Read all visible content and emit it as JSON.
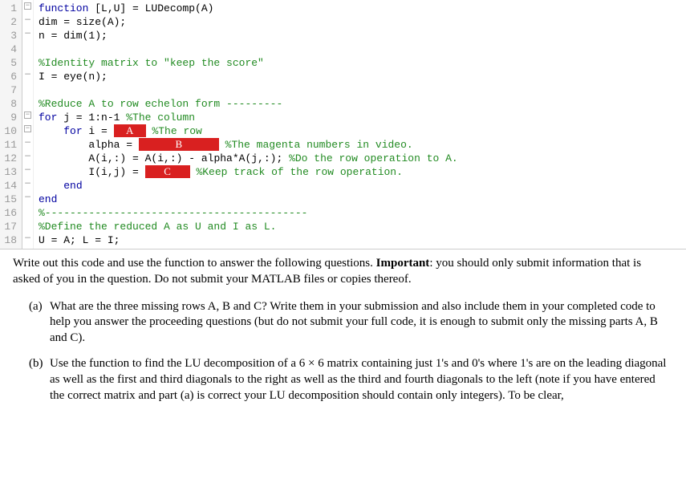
{
  "code": {
    "lines": [
      {
        "n": "1",
        "dash": "",
        "fold": "box",
        "segs": [
          {
            "t": "function",
            "c": "kw"
          },
          {
            "t": " [L,U] = LUDecomp(A)",
            "c": "fn"
          }
        ]
      },
      {
        "n": "2",
        "dash": "—",
        "fold": "",
        "segs": [
          {
            "t": "dim = size(A);",
            "c": "fn"
          }
        ]
      },
      {
        "n": "3",
        "dash": "—",
        "fold": "",
        "segs": [
          {
            "t": "n = dim(1);",
            "c": "fn"
          }
        ]
      },
      {
        "n": "4",
        "dash": "",
        "fold": "",
        "segs": [
          {
            "t": " ",
            "c": "fn"
          }
        ]
      },
      {
        "n": "5",
        "dash": "",
        "fold": "",
        "segs": [
          {
            "t": "%Identity matrix to \"keep the score\"",
            "c": "com"
          }
        ]
      },
      {
        "n": "6",
        "dash": "—",
        "fold": "",
        "segs": [
          {
            "t": "I = eye(n);",
            "c": "fn"
          }
        ]
      },
      {
        "n": "7",
        "dash": "",
        "fold": "",
        "segs": [
          {
            "t": " ",
            "c": "fn"
          }
        ]
      },
      {
        "n": "8",
        "dash": "",
        "fold": "",
        "segs": [
          {
            "t": "%Reduce A to row echelon form ---------",
            "c": "com"
          }
        ]
      },
      {
        "n": "9",
        "dash": "—",
        "fold": "box",
        "segs": [
          {
            "t": "for",
            "c": "kw"
          },
          {
            "t": " j = 1:n-1 ",
            "c": "fn"
          },
          {
            "t": "%The column",
            "c": "com"
          }
        ]
      },
      {
        "n": "10",
        "dash": "—",
        "fold": "box",
        "indent": 4,
        "segs": [
          {
            "t": "for",
            "c": "kw"
          },
          {
            "t": " i = ",
            "c": "fn"
          },
          {
            "box": "A",
            "w": "box-a"
          },
          {
            "t": " ",
            "c": "fn"
          },
          {
            "t": "%The row",
            "c": "com"
          }
        ]
      },
      {
        "n": "11",
        "dash": "—",
        "fold": "",
        "indent": 8,
        "segs": [
          {
            "t": "alpha = ",
            "c": "fn"
          },
          {
            "box": "B",
            "w": "box-b"
          },
          {
            "t": " ",
            "c": "fn"
          },
          {
            "t": "%The magenta numbers in video.",
            "c": "com"
          }
        ]
      },
      {
        "n": "12",
        "dash": "—",
        "fold": "",
        "indent": 8,
        "segs": [
          {
            "t": "A(i,:) = A(i,:) - alpha*A(j,:); ",
            "c": "fn"
          },
          {
            "t": "%Do the row operation to A.",
            "c": "com"
          }
        ]
      },
      {
        "n": "13",
        "dash": "—",
        "fold": "",
        "indent": 8,
        "segs": [
          {
            "t": "I(i,j) = ",
            "c": "fn"
          },
          {
            "box": "C",
            "w": "box-c"
          },
          {
            "t": " ",
            "c": "fn"
          },
          {
            "t": "%Keep track of the row operation.",
            "c": "com"
          }
        ]
      },
      {
        "n": "14",
        "dash": "—",
        "fold": "",
        "indent": 4,
        "segs": [
          {
            "t": "end",
            "c": "kw"
          }
        ]
      },
      {
        "n": "15",
        "dash": "—",
        "fold": "",
        "segs": [
          {
            "t": "end",
            "c": "kw"
          }
        ]
      },
      {
        "n": "16",
        "dash": "",
        "fold": "",
        "segs": [
          {
            "t": "%------------------------------------------",
            "c": "com"
          }
        ]
      },
      {
        "n": "17",
        "dash": "",
        "fold": "",
        "segs": [
          {
            "t": "%Define the reduced A as U and I as L.",
            "c": "com"
          }
        ]
      },
      {
        "n": "18",
        "dash": "—",
        "fold": "",
        "segs": [
          {
            "t": "U = A; L = I;",
            "c": "fn"
          }
        ]
      }
    ]
  },
  "intro": {
    "part1": "Write out this code and use the function to answer the following questions. ",
    "bold": "Important",
    "part2": ": you should only submit information that is asked of you in the question. Do not submit your MATLAB files or copies thereof."
  },
  "items": [
    {
      "marker": "(a)",
      "text": "What are the three missing rows A, B and C? Write them in your submission and also include them in your completed code to help you answer the proceeding questions (but do not submit your full code, it is enough to submit only the missing parts A, B and C)."
    },
    {
      "marker": "(b)",
      "text": "Use the function to find the LU decomposition of a 6 × 6 matrix containing just 1's and 0's where 1's are on the leading diagonal as well as the first and third diagonals to the right as well as the third and fourth diagonals to the left (note if you have entered the correct matrix and part (a) is correct your LU decomposition should contain only integers). To be clear,"
    }
  ]
}
